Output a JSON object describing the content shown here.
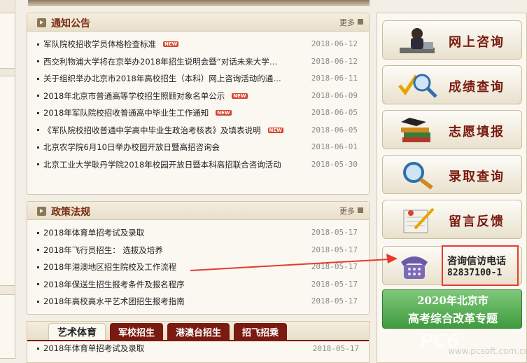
{
  "notices": {
    "title": "通知公告",
    "more": "更多",
    "items": [
      {
        "text": "军队院校招收学员体格检查标准",
        "new": true,
        "date": "2018-06-12"
      },
      {
        "text": "西交利物浦大学将在京举办2018年招生说明会暨“对话未来大学…",
        "new": false,
        "date": "2018-06-12"
      },
      {
        "text": "关于组织举办北京市2018年高校招生（本科）网上咨询活动的通…",
        "new": false,
        "date": "2018-06-11"
      },
      {
        "text": "2018年北京市普通高等学校招生照顾对象名单公示",
        "new": true,
        "date": "2018-06-09"
      },
      {
        "text": "2018年军队院校招收普通高中毕业生工作通知",
        "new": true,
        "date": "2018-06-05"
      },
      {
        "text": "《军队院校招收普通中学高中毕业生政治考核表》及填表说明",
        "new": true,
        "date": "2018-06-05"
      },
      {
        "text": "北京农学院6月10日举办校园开放日暨高招咨询会",
        "new": false,
        "date": "2018-06-01"
      },
      {
        "text": "北京工业大学耿丹学院2018年校园开放日暨本科高招联合咨询活动",
        "new": false,
        "date": "2018-05-30"
      }
    ]
  },
  "policy": {
    "title": "政策法规",
    "more": "更多",
    "items": [
      {
        "text": "2018年体育单招考试及录取",
        "date": "2018-05-17"
      },
      {
        "text": "2018年飞行员招生： 选拔及培养",
        "date": "2018-05-17"
      },
      {
        "text": "2018年港澳地区招生院校及工作流程",
        "date": "2018-05-17"
      },
      {
        "text": "2018年保送生招生报考条件及报名程序",
        "date": "2018-05-17"
      },
      {
        "text": "2018年高校高水平艺术团招生报考指南",
        "date": "2018-05-17"
      }
    ]
  },
  "tabs": {
    "items": [
      "艺术体育",
      "军校招生",
      "港澳台招生",
      "招飞招乘"
    ],
    "first_row": {
      "text": "2018年体育单招考试及录取",
      "date": "2018-05-17"
    }
  },
  "badge_new": "NEW",
  "sidebar": {
    "buttons": [
      "网上咨询",
      "成绩查询",
      "志愿填报",
      "录取查询",
      "留言反馈"
    ],
    "phone_title": "咨询信访电话",
    "phone_number": "82837100-1",
    "reform_line1": "2020年北京市",
    "reform_line2": "高考综合改革专题"
  },
  "watermark": {
    "text": "PC6",
    "url": "www.pcsoft.com.cn"
  },
  "colors": {
    "accent": "#7a1a10",
    "highlight": "#e63a2e",
    "reform_green": "#3f9a3e"
  }
}
